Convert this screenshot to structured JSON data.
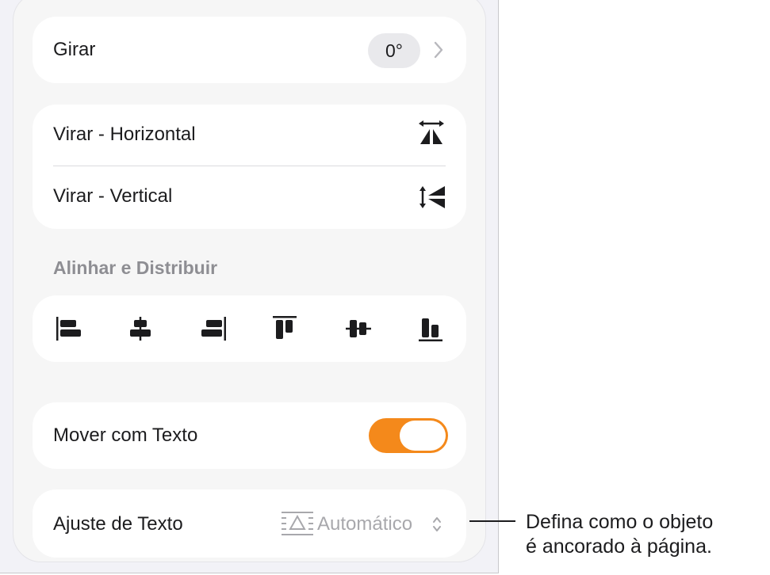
{
  "rotate": {
    "label": "Girar",
    "value": "0°"
  },
  "flip": {
    "horizontal_label": "Virar - Horizontal",
    "vertical_label": "Virar - Vertical"
  },
  "align_section": {
    "title": "Alinhar e Distribuir",
    "buttons": [
      {
        "icon": "align-left-icon"
      },
      {
        "icon": "align-center-horizontal-icon"
      },
      {
        "icon": "align-right-icon"
      },
      {
        "icon": "align-top-icon"
      },
      {
        "icon": "align-middle-vertical-icon"
      },
      {
        "icon": "align-bottom-icon"
      }
    ]
  },
  "move_with_text": {
    "label": "Mover com Texto",
    "enabled": true,
    "accent_color": "#f4891b"
  },
  "text_wrap": {
    "label": "Ajuste de Texto",
    "value": "Automático"
  },
  "callout": {
    "line1": "Defina como o objeto",
    "line2": "é ancorado à página."
  }
}
